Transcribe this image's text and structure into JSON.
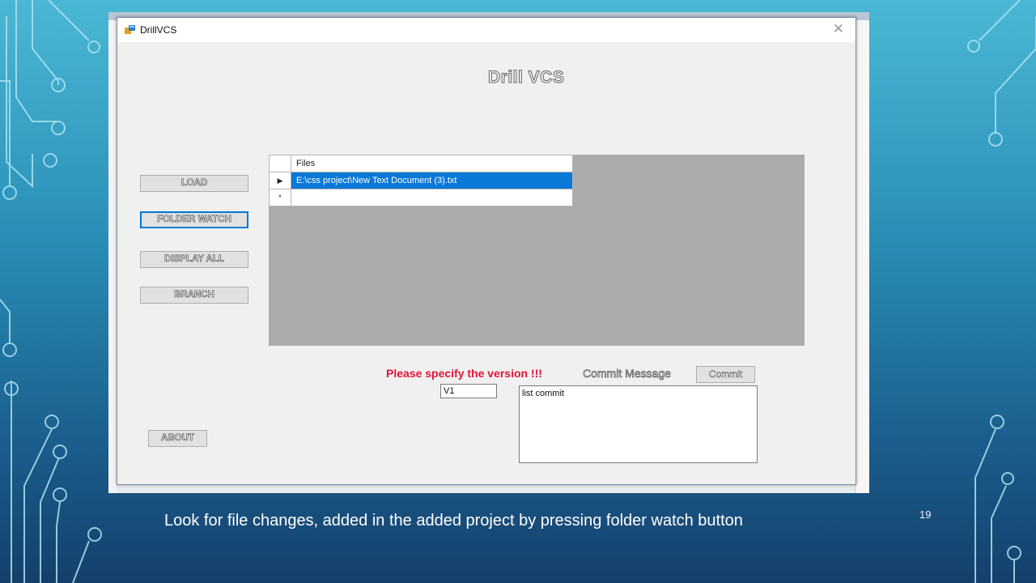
{
  "window": {
    "title": "DrillVCS",
    "close_glyph": "✕",
    "app_icon": "app-window-icon"
  },
  "app": {
    "heading": "Drill VCS",
    "buttons": {
      "load": "LOAD",
      "folder_watch": "FOLDER WATCH",
      "display_all": "DISPLAY ALL",
      "branch": "BRANCH",
      "about": "ABOUT"
    }
  },
  "grid": {
    "column_header": "Files",
    "rows": [
      {
        "indicator": "▶",
        "file": "E:\\css project\\New Text Document (3).txt",
        "selected": true
      },
      {
        "indicator": "*",
        "file": "",
        "selected": false
      }
    ]
  },
  "version": {
    "warning": "Please specify the version !!!",
    "value": "V1"
  },
  "commit": {
    "label": "Commit Message",
    "button": "Commit",
    "message": "list commit"
  },
  "slide": {
    "caption": "Look for file changes, added in the added project by pressing folder watch button",
    "number": "19"
  },
  "colors": {
    "accent": "#0078d7",
    "selection": "#0a78d7",
    "warning": "#e0163a",
    "grid_background": "#ababab"
  }
}
